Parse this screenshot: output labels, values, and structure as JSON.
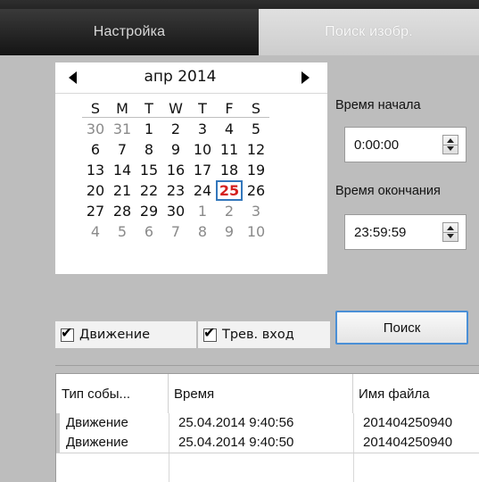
{
  "tabs": {
    "settings_label": "Настройка",
    "search_label": "Поиск изобр."
  },
  "calendar": {
    "month_label": "апр 2014",
    "weekdays": [
      "S",
      "M",
      "T",
      "W",
      "T",
      "F",
      "S"
    ],
    "weeks": [
      [
        {
          "d": "30",
          "other": true
        },
        {
          "d": "31",
          "other": true
        },
        {
          "d": "1"
        },
        {
          "d": "2"
        },
        {
          "d": "3"
        },
        {
          "d": "4"
        },
        {
          "d": "5"
        }
      ],
      [
        {
          "d": "6"
        },
        {
          "d": "7"
        },
        {
          "d": "8"
        },
        {
          "d": "9"
        },
        {
          "d": "10"
        },
        {
          "d": "11"
        },
        {
          "d": "12"
        }
      ],
      [
        {
          "d": "13"
        },
        {
          "d": "14"
        },
        {
          "d": "15"
        },
        {
          "d": "16"
        },
        {
          "d": "17"
        },
        {
          "d": "18"
        },
        {
          "d": "19"
        }
      ],
      [
        {
          "d": "20"
        },
        {
          "d": "21"
        },
        {
          "d": "22"
        },
        {
          "d": "23"
        },
        {
          "d": "24"
        },
        {
          "d": "25",
          "today": true
        },
        {
          "d": "26"
        }
      ],
      [
        {
          "d": "27"
        },
        {
          "d": "28"
        },
        {
          "d": "29"
        },
        {
          "d": "30"
        },
        {
          "d": "1",
          "other": true
        },
        {
          "d": "2",
          "other": true
        },
        {
          "d": "3",
          "other": true
        }
      ],
      [
        {
          "d": "4",
          "other": true
        },
        {
          "d": "5",
          "other": true
        },
        {
          "d": "6",
          "other": true
        },
        {
          "d": "7",
          "other": true
        },
        {
          "d": "8",
          "other": true
        },
        {
          "d": "9",
          "other": true
        },
        {
          "d": "10",
          "other": true
        }
      ]
    ],
    "today_color": "#d4211f",
    "selection_color": "#3377bb"
  },
  "time": {
    "start_label": "Время начала",
    "start_value": "0:00:00",
    "end_label": "Время окончания",
    "end_value": "23:59:59"
  },
  "filters": {
    "motion_label": "Движение",
    "motion_checked": true,
    "alarm_label": "Трев. вход",
    "alarm_checked": true,
    "check_mark": "✔"
  },
  "search_button": {
    "label": "Поиск"
  },
  "results": {
    "columns": [
      "Тип собы...",
      "Время",
      "Имя файла"
    ],
    "rows": [
      [
        "Движение",
        "25.04.2014 9:40:56",
        "201404250940"
      ],
      [
        "Движение",
        "25.04.2014 9:40:50",
        "201404250940"
      ]
    ]
  },
  "colors": {
    "accent": "#4a8fd6",
    "tab_dark": "#141414",
    "background": "#bdbdbd"
  }
}
